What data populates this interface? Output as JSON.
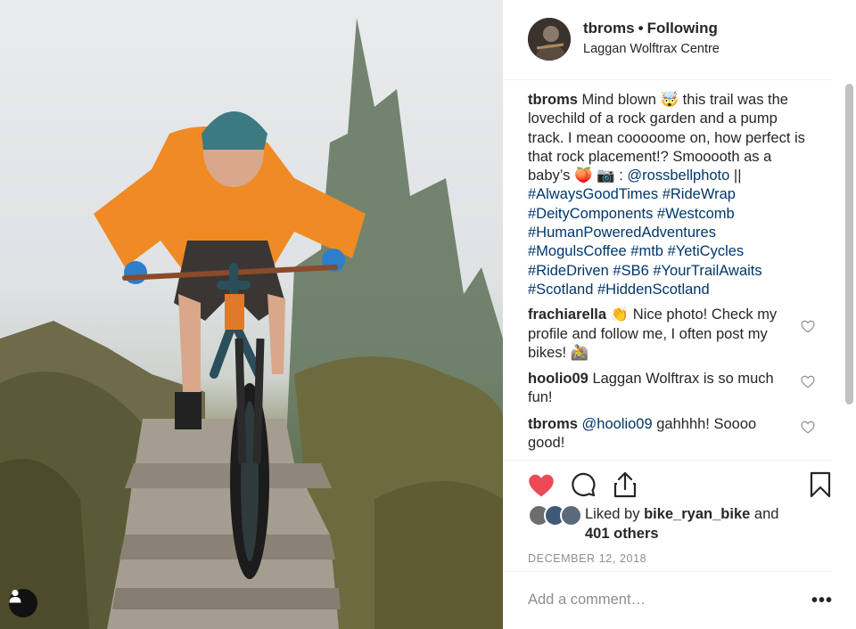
{
  "post": {
    "photo_alt": "mountain biker on rocky trail",
    "owner": {
      "username": "tbroms",
      "follow_status": "Following",
      "separator": "•",
      "location": "Laggan Wolftrax Centre"
    },
    "caption": {
      "username": "tbroms",
      "text": "Mind blown 🤯  this trail was the lovechild of a rock garden and a pump track. I mean cooooome on, how perfect is that rock placement!? Smooooth as a baby’s 🍑  📷 : ",
      "mention": "@rossbellphoto",
      "after_mention": " ||",
      "hashtags": [
        "#AlwaysGoodTimes",
        "#RideWrap",
        "#DeityComponents",
        "#Westcomb",
        "#HumanPoweredAdventures",
        "#MogulsCoffee",
        "#mtb",
        "#YetiCycles",
        "#RideDriven",
        "#SB6",
        "#YourTrailAwaits",
        "#Scotland",
        "#HiddenScotland"
      ]
    },
    "comments": [
      {
        "username": "frachiarella",
        "text": "👏  Nice photo! Check my profile and follow me, I often post my bikes! 🚵",
        "mention": ""
      },
      {
        "username": "hoolio09",
        "text": "Laggan Wolftrax is so much fun!",
        "mention": ""
      },
      {
        "username": "tbroms",
        "mention": "@hoolio09",
        "text": " gahhhh! Soooo good!"
      }
    ],
    "likes": {
      "prefix": "Liked by",
      "liked_by": "bike_ryan_bike",
      "conjunction": "and",
      "others": "401 others"
    },
    "date": "DECEMBER 12, 2018",
    "add_comment_placeholder": "Add a comment…",
    "more_label": "•••",
    "colors": {
      "like_red": "#ed4956",
      "link_blue": "#00376b",
      "secondary_text": "#8e8e8e"
    },
    "icons": {
      "like": "heart-filled-icon",
      "comment": "comment-bubble-icon",
      "share": "share-upload-icon",
      "save": "bookmark-icon",
      "comment_like": "heart-outline-icon",
      "tagged_user": "user-icon"
    }
  }
}
